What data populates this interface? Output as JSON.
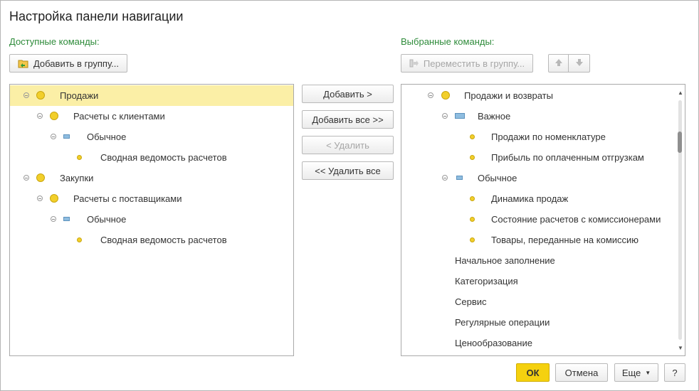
{
  "window": {
    "title": "Настройка панели навигации"
  },
  "left": {
    "caption": "Доступные команды:",
    "add_to_group_label": "Добавить в группу...",
    "tree": [
      {
        "label": "Продажи",
        "level": 0,
        "kind": "group",
        "selected": true
      },
      {
        "label": "Расчеты с клиентами",
        "level": 1,
        "kind": "group"
      },
      {
        "label": "Обычное",
        "level": 2,
        "kind": "section-normal"
      },
      {
        "label": "Сводная ведомость расчетов",
        "level": 3,
        "kind": "command"
      },
      {
        "label": "Закупки",
        "level": 0,
        "kind": "group"
      },
      {
        "label": "Расчеты с поставщиками",
        "level": 1,
        "kind": "group"
      },
      {
        "label": "Обычное",
        "level": 2,
        "kind": "section-normal"
      },
      {
        "label": "Сводная ведомость расчетов",
        "level": 3,
        "kind": "command"
      }
    ]
  },
  "middle": {
    "add_label": "Добавить >",
    "add_all_label": "Добавить все >>",
    "remove_label": "< Удалить",
    "remove_all_label": "<< Удалить все"
  },
  "right": {
    "caption": "Выбранные команды:",
    "move_to_group_label": "Переместить в группу...",
    "move_up_icon": "arrow-up-icon",
    "move_down_icon": "arrow-down-icon",
    "tree": [
      {
        "label": "Продажи и возвраты",
        "kind": "group"
      },
      {
        "label": "Важное",
        "kind": "section-important"
      },
      {
        "label": "Продажи по номенклатуре",
        "kind": "command"
      },
      {
        "label": "Прибыль по оплаченным отгрузкам",
        "kind": "command"
      },
      {
        "label": "Обычное",
        "kind": "section-normal"
      },
      {
        "label": "Динамика продаж",
        "kind": "command"
      },
      {
        "label": "Состояние расчетов с комиссионерами",
        "kind": "command"
      },
      {
        "label": "Товары, переданные на комиссию",
        "kind": "command"
      },
      {
        "label": "Начальное заполнение",
        "kind": "plain"
      },
      {
        "label": "Категоризация",
        "kind": "plain"
      },
      {
        "label": "Сервис",
        "kind": "plain"
      },
      {
        "label": "Регулярные операции",
        "kind": "plain"
      },
      {
        "label": "Ценообразование",
        "kind": "plain"
      }
    ]
  },
  "footer": {
    "ok_label": "ОК",
    "cancel_label": "Отмена",
    "more_label": "Еще",
    "help_label": "?"
  },
  "colors": {
    "accent_green": "#2e8b3a",
    "selection": "#fbefa6",
    "ok_button": "#f5d10f"
  }
}
